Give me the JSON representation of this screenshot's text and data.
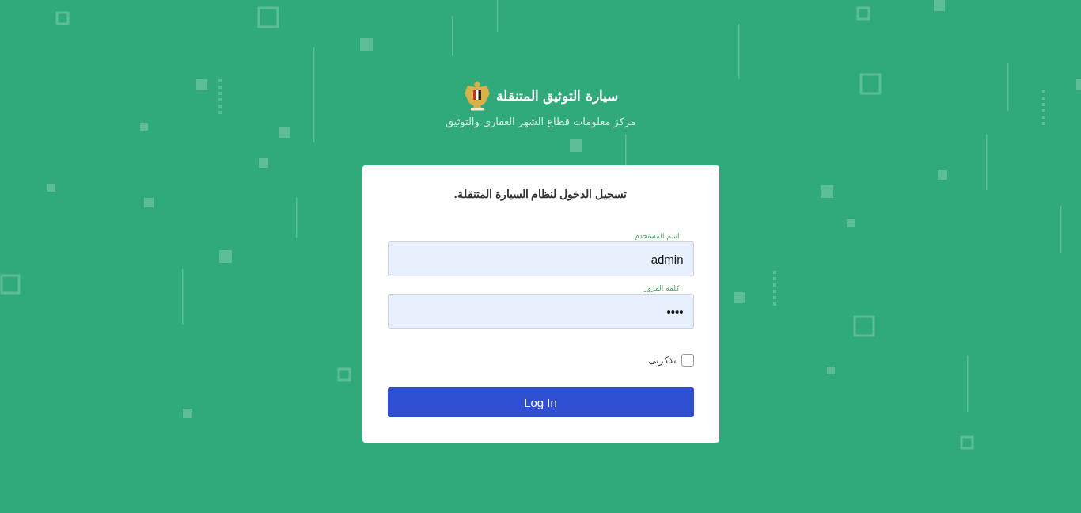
{
  "header": {
    "title": "سيارة التوثيق المتنقلة",
    "subtitle": "مركز معلومات قطاع الشهر العقارى والتوثيق"
  },
  "login_card": {
    "title": "تسجيل الدخول لنظام السيارة المتنقلة.",
    "fields": [
      {
        "label": "اسم المستخدم",
        "value": "admin"
      },
      {
        "label": "كلمة المرور",
        "value": "••••"
      }
    ],
    "remember_me": {
      "label": "تذكرنى",
      "checked": false
    },
    "submit_button": "Log In"
  }
}
